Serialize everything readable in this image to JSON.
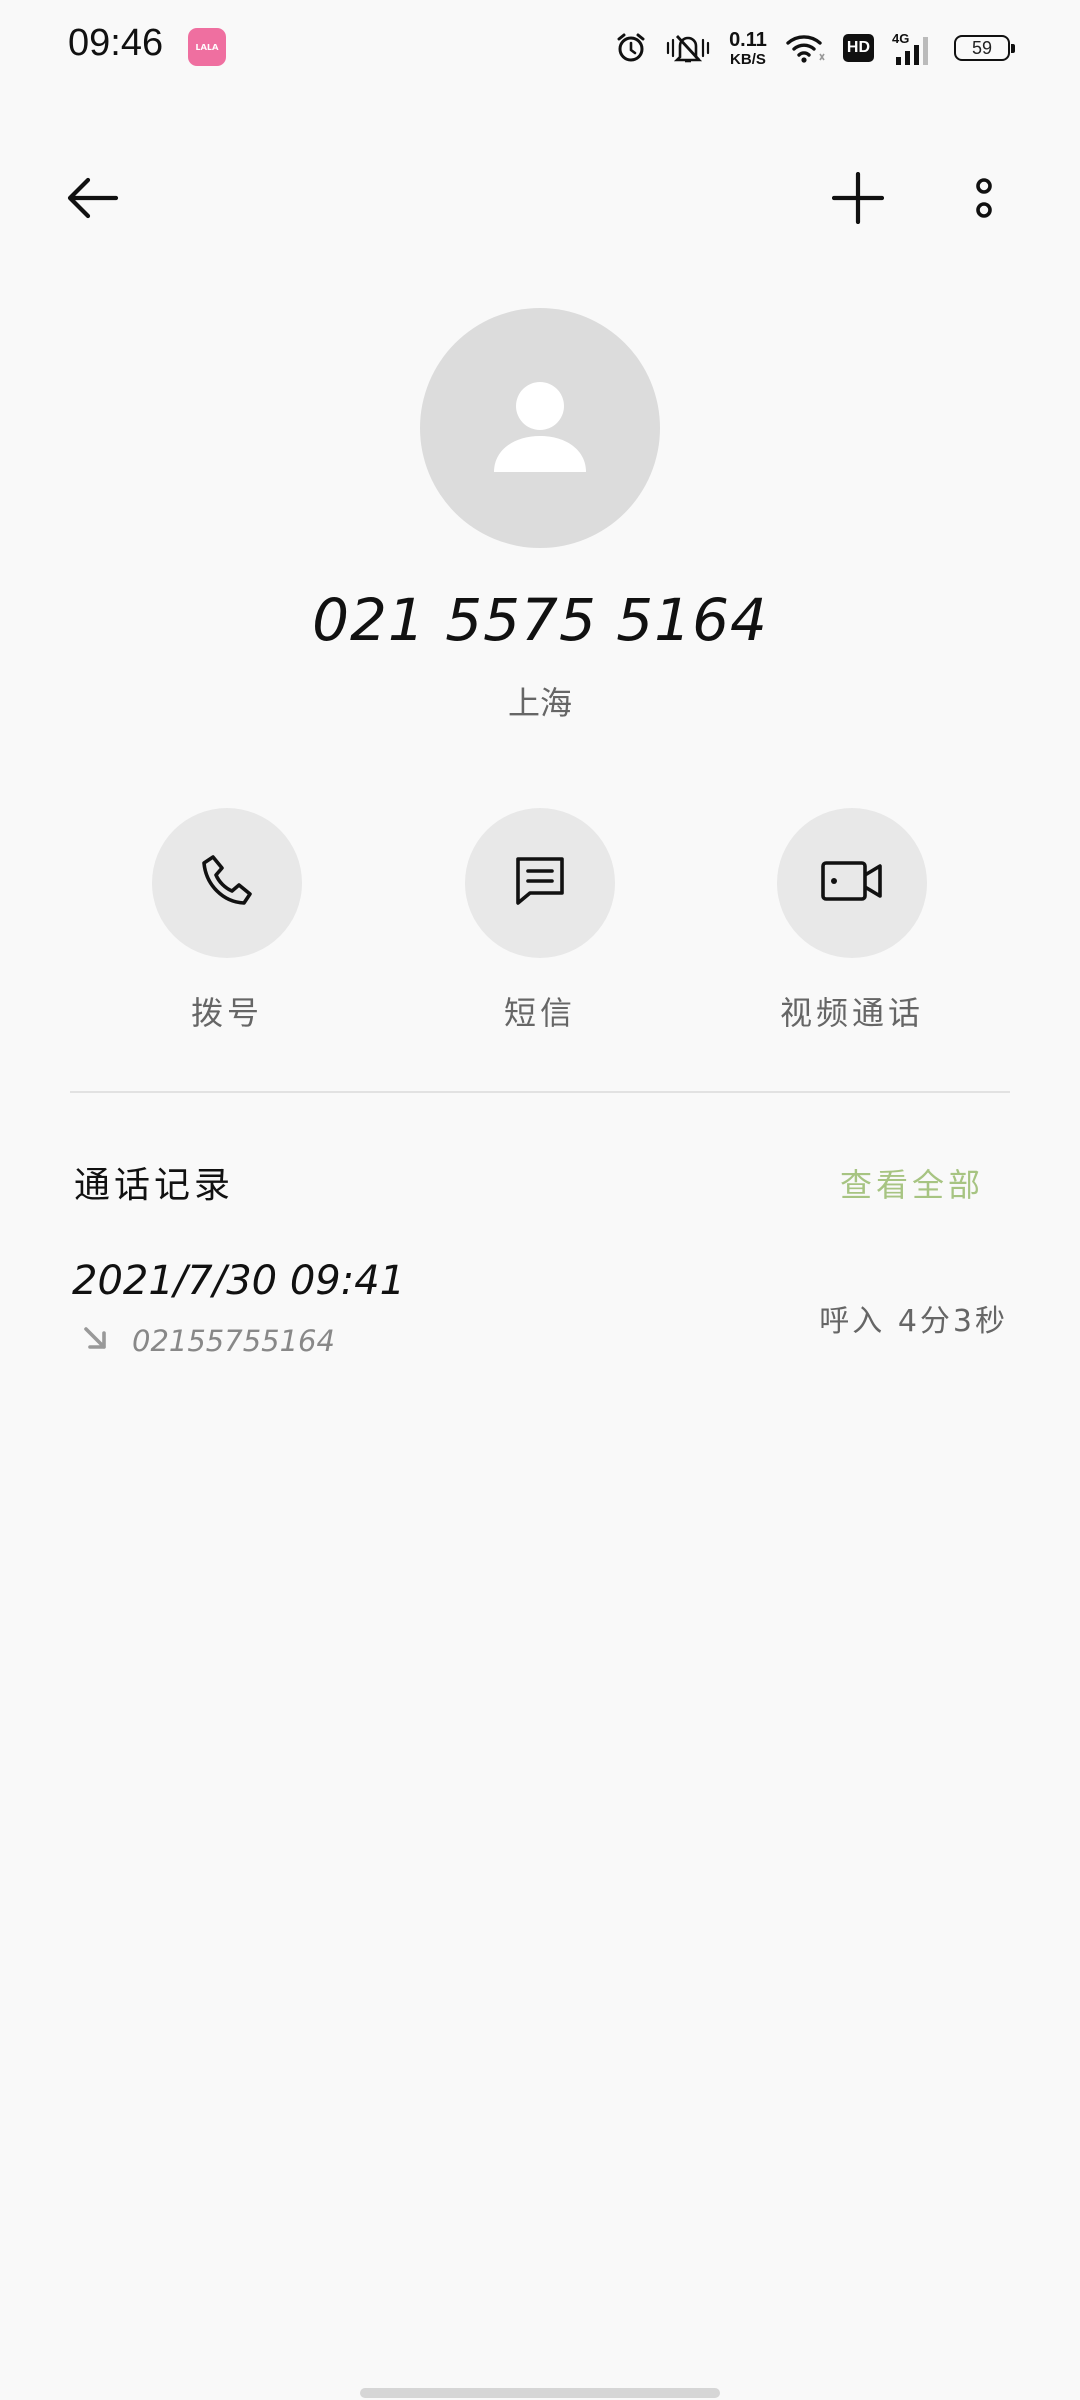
{
  "status_bar": {
    "time": "09:46",
    "app_badge": "ʟᴀʟᴀ",
    "net_speed_value": "0.11",
    "net_speed_unit": "KB/S",
    "hd_label": "HD",
    "signal_label": "4G",
    "battery": "59"
  },
  "contact": {
    "number": "021 5575 5164",
    "location": "上海"
  },
  "actions": {
    "call_label": "拨号",
    "sms_label": "短信",
    "video_label": "视频通话"
  },
  "call_log": {
    "title": "通话记录",
    "view_all_label": "查看全部",
    "entries": [
      {
        "datetime": "2021/7/30 09:41",
        "number": "02155755164",
        "detail": "呼入 4分3秒",
        "direction_icon": "incoming-arrow-icon"
      }
    ]
  },
  "colors": {
    "background": "#f9f9f9",
    "accent": "#a7c482",
    "circle": "#e8e8e8",
    "avatar": "#dcdcdc"
  }
}
